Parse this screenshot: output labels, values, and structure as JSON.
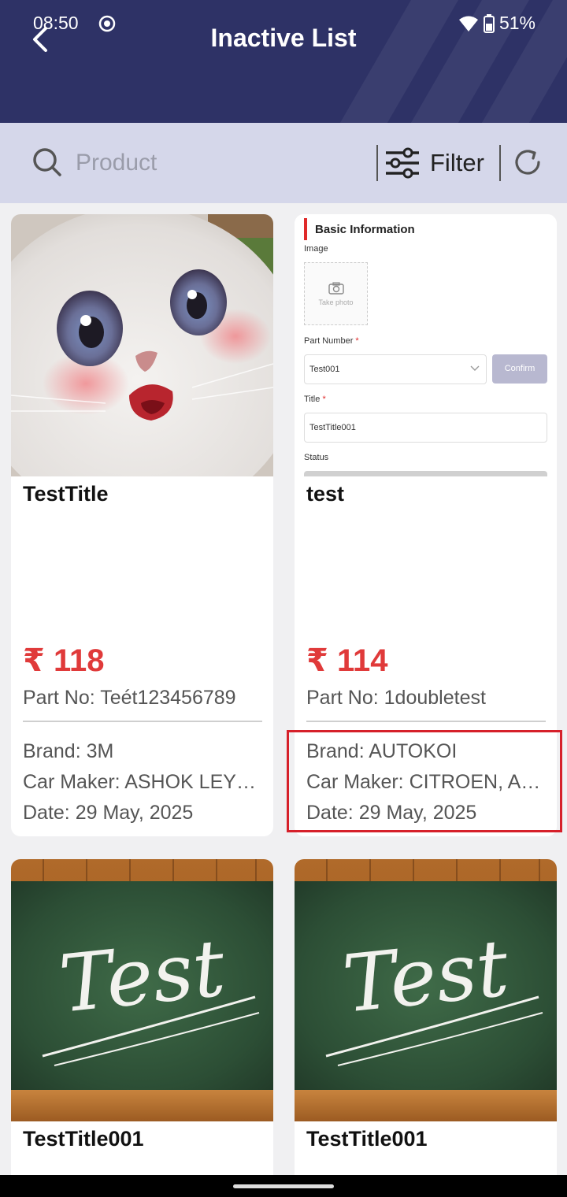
{
  "status_bar": {
    "time": "08:50",
    "battery": "51%"
  },
  "header": {
    "title": "Inactive List"
  },
  "search": {
    "placeholder": "Product",
    "filter_label": "Filter"
  },
  "colors": {
    "header_bg": "#2e3266",
    "search_bg": "#d5d7ea",
    "price": "#e03a3a",
    "highlight": "#d6202a"
  },
  "products": [
    {
      "title": "TestTitle",
      "price": "₹ 118",
      "part_no": "Part No: Teét123456789",
      "brand": "Brand: 3M",
      "car_maker": "Car Maker: ASHOK LEYLAND",
      "date": "Date: 29 May, 2025",
      "image": "white-kitten-photo"
    },
    {
      "title": "test",
      "price": "₹ 114",
      "part_no": "Part No: 1doubletest",
      "brand": "Brand: AUTOKOI",
      "car_maker": "Car Maker: CITROEN, ASHOK LEYLAND",
      "date": "Date: 29 May, 2025",
      "image": "form-screenshot",
      "image_text": {
        "heading": "Basic Information",
        "image_label": "Image",
        "take_photo": "Take photo",
        "part_number_label": "Part Number",
        "part_number_value": "Test001",
        "confirm": "Confirm",
        "title_label": "Title",
        "title_value": "TestTitle001",
        "status_label": "Status"
      }
    },
    {
      "title": "TestTitle001",
      "image": "chalkboard-test",
      "image_text": "Test"
    },
    {
      "title": "TestTitle001",
      "image": "chalkboard-test",
      "image_text": "Test"
    }
  ]
}
